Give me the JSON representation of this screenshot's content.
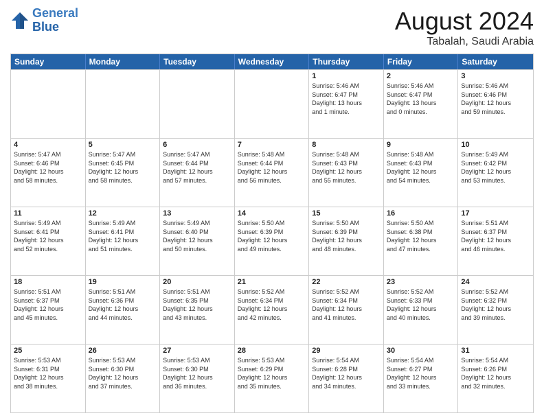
{
  "logo": {
    "line1": "General",
    "line2": "Blue"
  },
  "header": {
    "month": "August 2024",
    "location": "Tabalah, Saudi Arabia"
  },
  "days_of_week": [
    "Sunday",
    "Monday",
    "Tuesday",
    "Wednesday",
    "Thursday",
    "Friday",
    "Saturday"
  ],
  "weeks": [
    [
      {
        "day": "",
        "info": ""
      },
      {
        "day": "",
        "info": ""
      },
      {
        "day": "",
        "info": ""
      },
      {
        "day": "",
        "info": ""
      },
      {
        "day": "1",
        "info": "Sunrise: 5:46 AM\nSunset: 6:47 PM\nDaylight: 13 hours\nand 1 minute."
      },
      {
        "day": "2",
        "info": "Sunrise: 5:46 AM\nSunset: 6:47 PM\nDaylight: 13 hours\nand 0 minutes."
      },
      {
        "day": "3",
        "info": "Sunrise: 5:46 AM\nSunset: 6:46 PM\nDaylight: 12 hours\nand 59 minutes."
      }
    ],
    [
      {
        "day": "4",
        "info": "Sunrise: 5:47 AM\nSunset: 6:46 PM\nDaylight: 12 hours\nand 58 minutes."
      },
      {
        "day": "5",
        "info": "Sunrise: 5:47 AM\nSunset: 6:45 PM\nDaylight: 12 hours\nand 58 minutes."
      },
      {
        "day": "6",
        "info": "Sunrise: 5:47 AM\nSunset: 6:44 PM\nDaylight: 12 hours\nand 57 minutes."
      },
      {
        "day": "7",
        "info": "Sunrise: 5:48 AM\nSunset: 6:44 PM\nDaylight: 12 hours\nand 56 minutes."
      },
      {
        "day": "8",
        "info": "Sunrise: 5:48 AM\nSunset: 6:43 PM\nDaylight: 12 hours\nand 55 minutes."
      },
      {
        "day": "9",
        "info": "Sunrise: 5:48 AM\nSunset: 6:43 PM\nDaylight: 12 hours\nand 54 minutes."
      },
      {
        "day": "10",
        "info": "Sunrise: 5:49 AM\nSunset: 6:42 PM\nDaylight: 12 hours\nand 53 minutes."
      }
    ],
    [
      {
        "day": "11",
        "info": "Sunrise: 5:49 AM\nSunset: 6:41 PM\nDaylight: 12 hours\nand 52 minutes."
      },
      {
        "day": "12",
        "info": "Sunrise: 5:49 AM\nSunset: 6:41 PM\nDaylight: 12 hours\nand 51 minutes."
      },
      {
        "day": "13",
        "info": "Sunrise: 5:49 AM\nSunset: 6:40 PM\nDaylight: 12 hours\nand 50 minutes."
      },
      {
        "day": "14",
        "info": "Sunrise: 5:50 AM\nSunset: 6:39 PM\nDaylight: 12 hours\nand 49 minutes."
      },
      {
        "day": "15",
        "info": "Sunrise: 5:50 AM\nSunset: 6:39 PM\nDaylight: 12 hours\nand 48 minutes."
      },
      {
        "day": "16",
        "info": "Sunrise: 5:50 AM\nSunset: 6:38 PM\nDaylight: 12 hours\nand 47 minutes."
      },
      {
        "day": "17",
        "info": "Sunrise: 5:51 AM\nSunset: 6:37 PM\nDaylight: 12 hours\nand 46 minutes."
      }
    ],
    [
      {
        "day": "18",
        "info": "Sunrise: 5:51 AM\nSunset: 6:37 PM\nDaylight: 12 hours\nand 45 minutes."
      },
      {
        "day": "19",
        "info": "Sunrise: 5:51 AM\nSunset: 6:36 PM\nDaylight: 12 hours\nand 44 minutes."
      },
      {
        "day": "20",
        "info": "Sunrise: 5:51 AM\nSunset: 6:35 PM\nDaylight: 12 hours\nand 43 minutes."
      },
      {
        "day": "21",
        "info": "Sunrise: 5:52 AM\nSunset: 6:34 PM\nDaylight: 12 hours\nand 42 minutes."
      },
      {
        "day": "22",
        "info": "Sunrise: 5:52 AM\nSunset: 6:34 PM\nDaylight: 12 hours\nand 41 minutes."
      },
      {
        "day": "23",
        "info": "Sunrise: 5:52 AM\nSunset: 6:33 PM\nDaylight: 12 hours\nand 40 minutes."
      },
      {
        "day": "24",
        "info": "Sunrise: 5:52 AM\nSunset: 6:32 PM\nDaylight: 12 hours\nand 39 minutes."
      }
    ],
    [
      {
        "day": "25",
        "info": "Sunrise: 5:53 AM\nSunset: 6:31 PM\nDaylight: 12 hours\nand 38 minutes."
      },
      {
        "day": "26",
        "info": "Sunrise: 5:53 AM\nSunset: 6:30 PM\nDaylight: 12 hours\nand 37 minutes."
      },
      {
        "day": "27",
        "info": "Sunrise: 5:53 AM\nSunset: 6:30 PM\nDaylight: 12 hours\nand 36 minutes."
      },
      {
        "day": "28",
        "info": "Sunrise: 5:53 AM\nSunset: 6:29 PM\nDaylight: 12 hours\nand 35 minutes."
      },
      {
        "day": "29",
        "info": "Sunrise: 5:54 AM\nSunset: 6:28 PM\nDaylight: 12 hours\nand 34 minutes."
      },
      {
        "day": "30",
        "info": "Sunrise: 5:54 AM\nSunset: 6:27 PM\nDaylight: 12 hours\nand 33 minutes."
      },
      {
        "day": "31",
        "info": "Sunrise: 5:54 AM\nSunset: 6:26 PM\nDaylight: 12 hours\nand 32 minutes."
      }
    ]
  ]
}
